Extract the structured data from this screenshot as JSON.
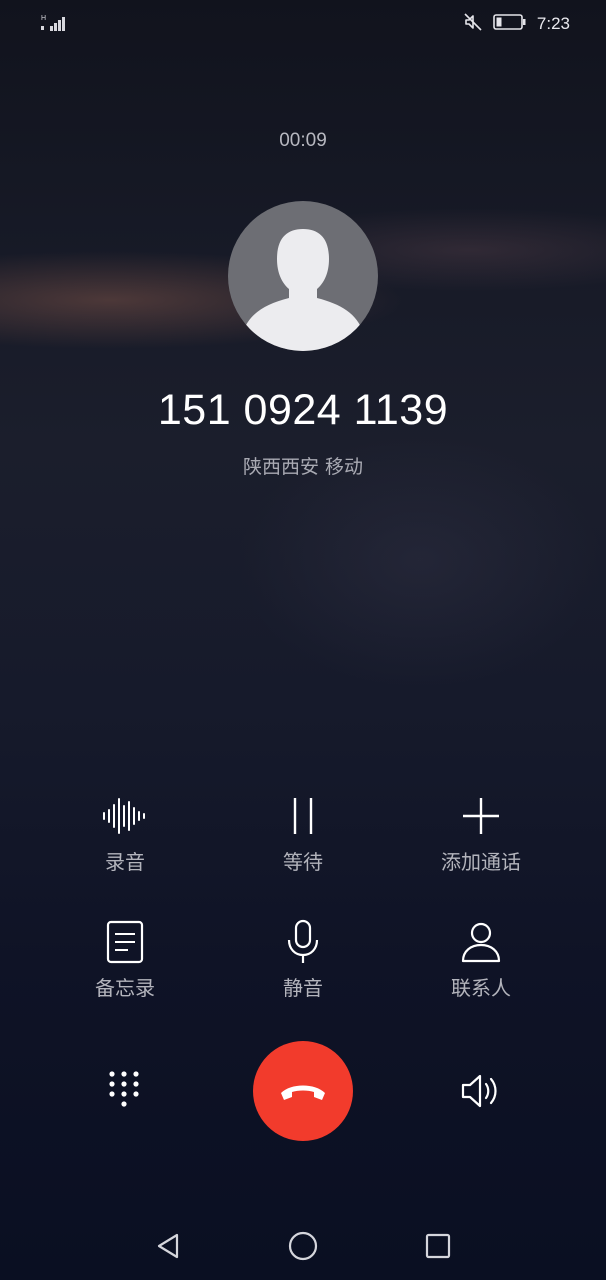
{
  "status_bar": {
    "signal_small_label": "H",
    "time": "7:23",
    "icons": [
      "signal-icon",
      "mute-icon",
      "battery-icon"
    ]
  },
  "call": {
    "timer": "00:09",
    "number": "151 0924 1139",
    "location": "陕西西安 移动"
  },
  "actions": {
    "record": "录音",
    "hold": "等待",
    "add_call": "添加通话",
    "memo": "备忘录",
    "mute": "静音",
    "contacts": "联系人"
  },
  "bottom_controls": [
    "dialpad-icon",
    "end-call-icon",
    "speaker-icon"
  ],
  "navigation": [
    "back-icon",
    "home-icon",
    "recents-icon"
  ],
  "colors": {
    "end_call": "#f23b2c",
    "label": "#b3b4bc"
  }
}
